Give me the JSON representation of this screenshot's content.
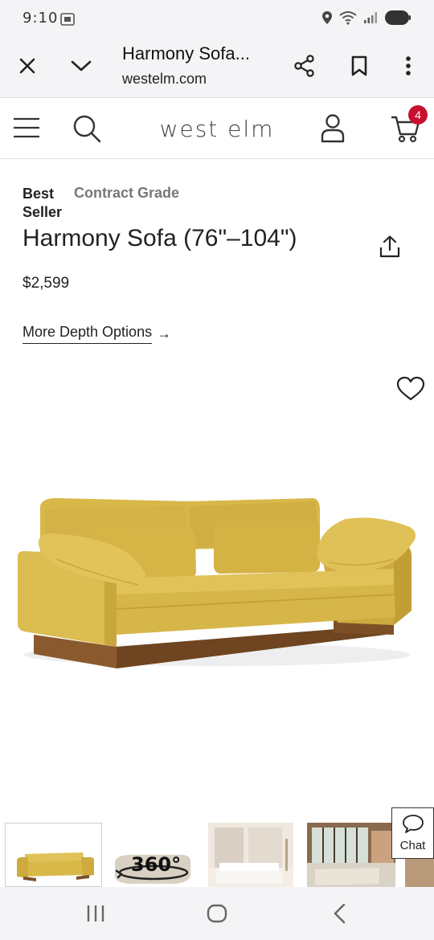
{
  "status_bar": {
    "time": "9:10",
    "icons": [
      "screenshot-icon",
      "location-icon",
      "wifi-icon",
      "signal-icon",
      "battery-icon"
    ]
  },
  "browser": {
    "title": "Harmony Sofa...",
    "url": "westelm.com",
    "icons": [
      "close-icon",
      "chevron-down-icon",
      "share-icon",
      "bookmark-icon",
      "more-vert-icon"
    ]
  },
  "site_header": {
    "brand": "west elm",
    "cart_count": "4",
    "icons": [
      "hamburger-icon",
      "search-icon",
      "account-icon",
      "cart-icon"
    ]
  },
  "product": {
    "badge_best": "Best Seller",
    "badge_grade": "Contract Grade",
    "title": "Harmony Sofa (76\"–104\")",
    "price": "$2,599",
    "depth_link": "More Depth Options",
    "depth_arrow": "→",
    "sofa_color": "#d9b84a"
  },
  "thumbnails": {
    "count": 5,
    "badge_360": "360°"
  },
  "chat": {
    "label": "Chat"
  },
  "nav_bar": {
    "icons": [
      "recents-icon",
      "home-icon",
      "back-icon"
    ]
  },
  "colors": {
    "accent_badge": "#c8102e",
    "chrome_bg": "#f4f4f6"
  }
}
